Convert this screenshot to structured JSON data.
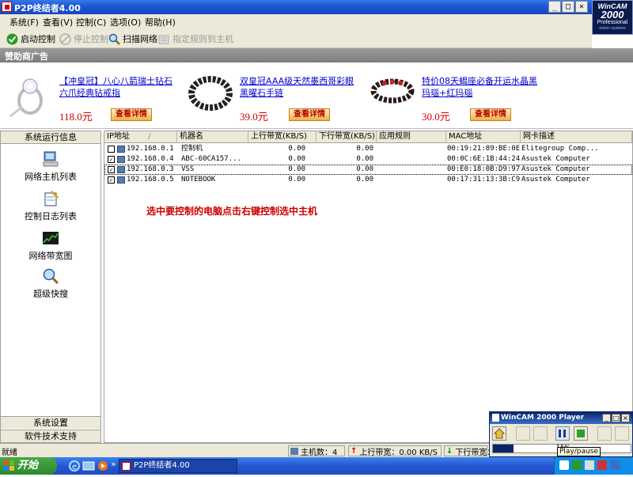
{
  "window": {
    "title": "P2P终结者4.00"
  },
  "wincam_logo": {
    "line1": "WinCAM",
    "line2": "2000",
    "line3": "Professional",
    "line4": "mirlon systems"
  },
  "menu": [
    "系统(F)",
    "查看(V)",
    "控制(C)",
    "选项(O)",
    "帮助(H)"
  ],
  "toolbar": {
    "start_control": "启动控制",
    "stop_control": "停止控制",
    "scan_network": "扫描网络",
    "assign_rule": "指定规则到主机"
  },
  "sponsor": {
    "title": "赞助商广告"
  },
  "ads": [
    {
      "title": "【冲皇冠】八心八箭瑞士钻石六爪经典钻戒指",
      "price": "118.0元",
      "button": "查看详情"
    },
    {
      "title": "双皇冠AAA级天然墨西哥彩眼黑曜石手链",
      "price": "39.0元",
      "button": "查看详情"
    },
    {
      "title": "特价08天蝎座必备开运水晶黑玛瑙+红玛瑙",
      "price": "30.0元",
      "button": "查看详情"
    }
  ],
  "left_panel": {
    "header": "系统运行信息",
    "items": [
      "网络主机列表",
      "控制日志列表",
      "网络带宽图",
      "超级快搜"
    ],
    "bottom": [
      "系统设置",
      "软件技术支持"
    ]
  },
  "table": {
    "columns": [
      "IP地址",
      "机器名",
      "上行带宽(KB/S)",
      "下行带宽(KB/S)",
      "应用规则",
      "MAC地址",
      "网卡描述"
    ],
    "sort_indicator": "/",
    "rows": [
      {
        "checked": false,
        "ip": "192.168.0.1",
        "name": "控制机",
        "up": "0.00",
        "down": "0.00",
        "rule": "",
        "mac": "00:19:21:89:BE:0E",
        "nic": "Elitegroup Comp..."
      },
      {
        "checked": true,
        "ip": "192.168.0.4",
        "name": "ABC-60CA157...",
        "up": "0.00",
        "down": "0.00",
        "rule": "",
        "mac": "00:0C:6E:1B:44:24",
        "nic": "Asustek Computer"
      },
      {
        "checked": true,
        "ip": "192.168.0.3",
        "name": "VSS",
        "up": "0.00",
        "down": "0.00",
        "rule": "",
        "mac": "00:E0:18:0B:D9:97",
        "nic": "Asustek Computer"
      },
      {
        "checked": true,
        "ip": "192.168.0.5",
        "name": "NOTEBOOK",
        "up": "0.00",
        "down": "0.00",
        "rule": "",
        "mac": "00:17:31:13:3B:C9",
        "nic": "Asustek Computer"
      }
    ]
  },
  "annotation": "选中要控制的电脑点击右键控制选中主机",
  "status": {
    "ready": "就绪",
    "hosts": "主机数：4",
    "upload": "上行带宽：0.00 KB/S",
    "download": "下行带宽："
  },
  "taskbar": {
    "start": "开始",
    "item": "P2P终结者4.00",
    "more": "»"
  },
  "player": {
    "title": "WinCAM 2000 Player",
    "tooltip": "Play/pause",
    "progress_text": "15%"
  },
  "colors": {
    "titlebar": "#1c58d6",
    "hint": "#cc0000",
    "price": "#cc0000",
    "link": "#0000cc"
  }
}
